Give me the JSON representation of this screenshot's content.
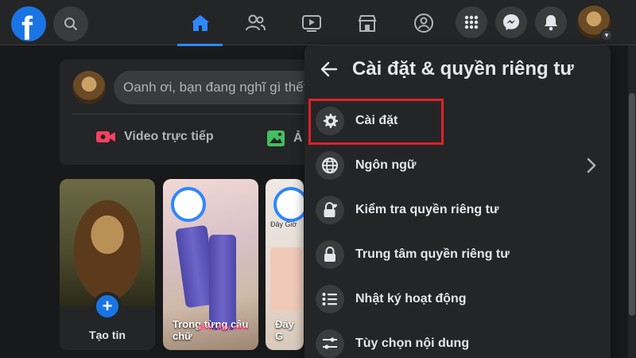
{
  "colors": {
    "background": "#18191a",
    "surface": "#242526",
    "accent": "#2d88ff",
    "brand": "#1b74e4",
    "highlight_border": "#e0202a",
    "live_video": "#f3425f",
    "photo": "#45bd62"
  },
  "topbar": {
    "logo_letter": "f",
    "icons": [
      "facebook-logo",
      "search-icon",
      "home-icon",
      "friends-icon",
      "watch-icon",
      "marketplace-icon",
      "groups-icon",
      "menu-grid-icon",
      "messenger-icon",
      "notifications-icon",
      "profile-avatar"
    ]
  },
  "composer": {
    "placeholder": "Oanh ơi, bạn đang nghĩ gì thế?",
    "live_video_label": "Video trực tiếp",
    "photo_label_partial": "Ả"
  },
  "stories": {
    "create_label": "Tạo tin",
    "story2_caption": "Trong từng câu chữ",
    "story2_overlay": "Mới, đáy nha",
    "story3_caption": "Đáy G",
    "story3_title": "Đây Giờ"
  },
  "menu": {
    "title": "Cài đặt & quyền riêng tư",
    "items": [
      {
        "label": "Cài đặt",
        "icon": "gear-icon"
      },
      {
        "label": "Ngôn ngữ",
        "icon": "globe-icon"
      },
      {
        "label": "Kiểm tra quyền riêng tư",
        "icon": "lock-heart-icon"
      },
      {
        "label": "Trung tâm quyền riêng tư",
        "icon": "lock-icon"
      },
      {
        "label": "Nhật ký hoạt động",
        "icon": "list-icon"
      },
      {
        "label": "Tùy chọn nội dung",
        "icon": "sliders-icon"
      }
    ]
  }
}
